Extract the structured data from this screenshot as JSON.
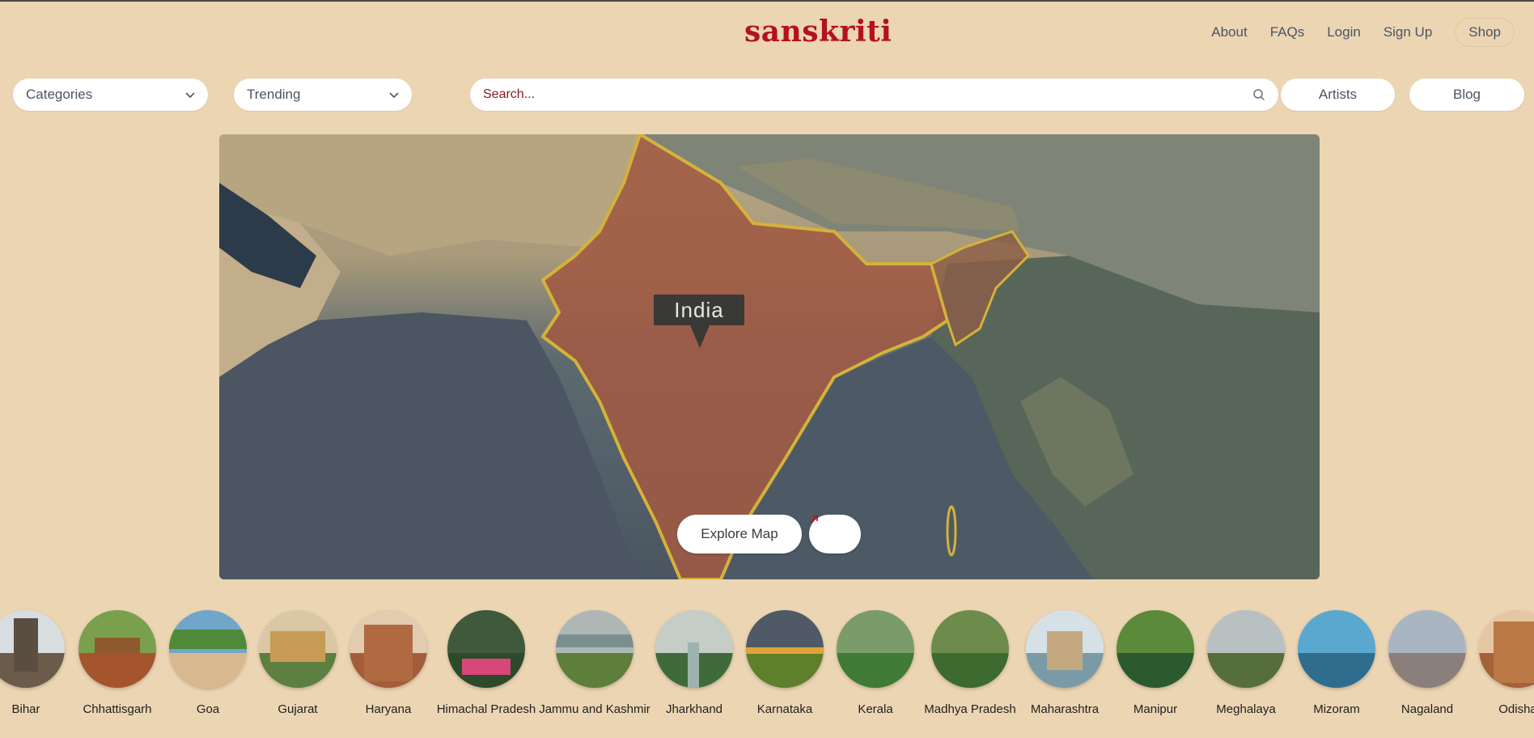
{
  "header": {
    "logo": "sanskriti",
    "nav": [
      {
        "label": "About"
      },
      {
        "label": "FAQs"
      },
      {
        "label": "Login"
      },
      {
        "label": "Sign Up"
      },
      {
        "label": "Shop"
      }
    ]
  },
  "filters": {
    "categories": {
      "value": "Categories"
    },
    "trending": {
      "value": "Trending"
    },
    "search": {
      "placeholder": "Search..."
    },
    "artists": "Artists",
    "blog": "Blog"
  },
  "map": {
    "label": "India",
    "explore_button": "Explore Map"
  },
  "states": [
    {
      "name": "Bihar"
    },
    {
      "name": "Chhattisgarh"
    },
    {
      "name": "Goa"
    },
    {
      "name": "Gujarat"
    },
    {
      "name": "Haryana"
    },
    {
      "name": "Himachal Pradesh"
    },
    {
      "name": "Jammu and Kashmir"
    },
    {
      "name": "Jharkhand"
    },
    {
      "name": "Karnataka"
    },
    {
      "name": "Kerala"
    },
    {
      "name": "Madhya Pradesh"
    },
    {
      "name": "Maharashtra"
    },
    {
      "name": "Manipur"
    },
    {
      "name": "Meghalaya"
    },
    {
      "name": "Mizoram"
    },
    {
      "name": "Nagaland"
    },
    {
      "name": "Odisha"
    }
  ],
  "colors": {
    "background": "#ecd5b3",
    "brand_red": "#b3121b",
    "search_placeholder": "#8b1a1a"
  },
  "icons": {
    "dropdown": "chevron-down-icon",
    "search": "search-icon",
    "external": "arrow-up-right-icon"
  }
}
